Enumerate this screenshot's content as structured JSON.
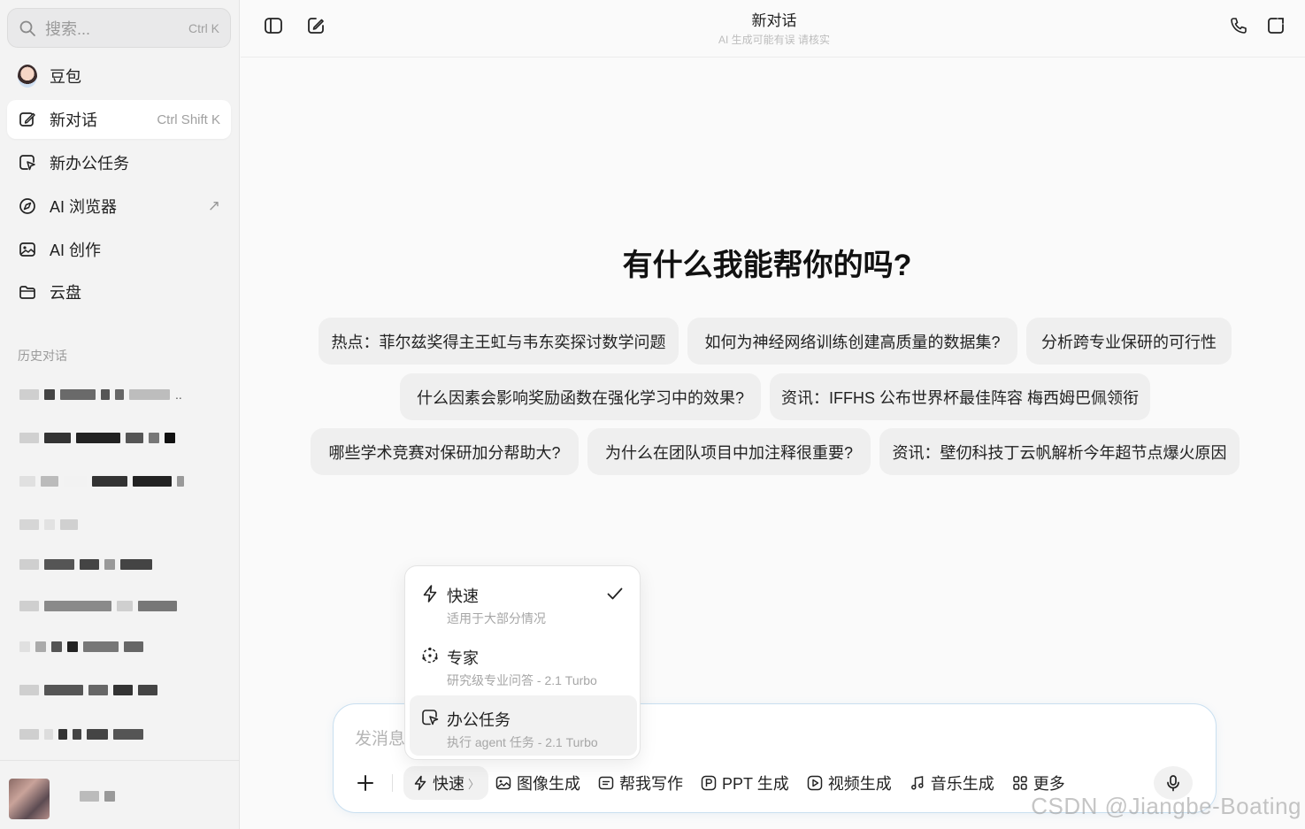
{
  "sidebar": {
    "search": {
      "placeholder": "搜索...",
      "shortcut": "Ctrl K"
    },
    "items": [
      {
        "label": "豆包",
        "hint": ""
      },
      {
        "label": "新对话",
        "hint": "Ctrl Shift K"
      },
      {
        "label": "新办公任务",
        "hint": ""
      },
      {
        "label": "AI 浏览器",
        "hint": "↗"
      },
      {
        "label": "AI 创作",
        "hint": ""
      },
      {
        "label": "云盘",
        "hint": ""
      }
    ],
    "history_title": "历史对话",
    "history_ellipsis": ".."
  },
  "header": {
    "title": "新对话",
    "subtitle": "AI 生成可能有误 请核实"
  },
  "main": {
    "welcome": "有什么我能帮你的吗?",
    "suggestions": [
      "热点：菲尔兹奖得主王虹与韦东奕探讨数学问题",
      "如何为神经网络训练创建高质量的数据集?",
      "分析跨专业保研的可行性",
      "什么因素会影响奖励函数在强化学习中的效果?",
      "资讯：IFFHS 公布世界杯最佳阵容 梅西姆巴佩领衔",
      "哪些学术竞赛对保研加分帮助大?",
      "为什么在团队项目中加注释很重要?",
      "资讯：壁仞科技丁云帆解析今年超节点爆火原因"
    ]
  },
  "composer": {
    "placeholder": "发消息",
    "mode": "快速",
    "tools": [
      "图像生成",
      "帮我写作",
      "PPT 生成",
      "视频生成",
      "音乐生成",
      "更多"
    ]
  },
  "dropdown": {
    "items": [
      {
        "name": "快速",
        "desc": "适用于大部分情况",
        "selected": true
      },
      {
        "name": "专家",
        "desc": "研究级专业问答 - 2.1 Turbo",
        "selected": false
      },
      {
        "name": "办公任务",
        "desc": "执行 agent 任务 - 2.1 Turbo",
        "selected": false
      }
    ]
  },
  "watermark": "CSDN @Jiangbe-Boating"
}
